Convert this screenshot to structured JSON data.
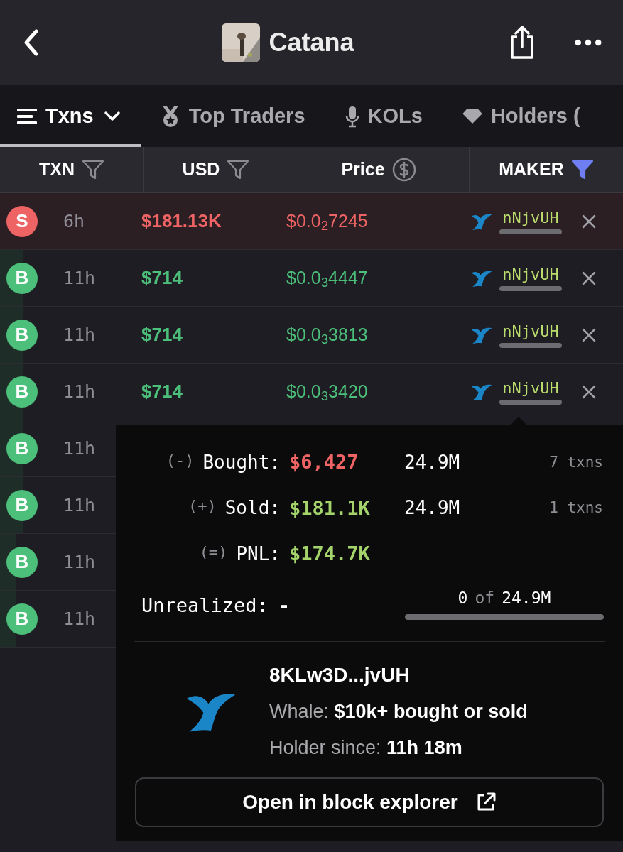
{
  "header": {
    "title": "Catana"
  },
  "tabs": [
    {
      "label": "Txns",
      "kind": "menu",
      "selected": true
    },
    {
      "label": "Top Traders",
      "kind": "medal",
      "selected": false
    },
    {
      "label": "KOLs",
      "kind": "mic",
      "selected": false
    },
    {
      "label": "Holders (",
      "kind": "diamond",
      "selected": false
    }
  ],
  "table": {
    "columns": [
      {
        "label": "TXN",
        "kind": "filter",
        "active": false
      },
      {
        "label": "USD",
        "kind": "filter",
        "active": false
      },
      {
        "label": "Price",
        "kind": "dollar",
        "active": false
      },
      {
        "label": "MAKER",
        "kind": "filter",
        "active": true
      }
    ],
    "rows": [
      {
        "side": "S",
        "time": "6h",
        "usd": "$181.13K",
        "price": "$0.0$_{2}$7245",
        "maker": "nNjvUH",
        "level": 1
      },
      {
        "side": "B",
        "time": "11h",
        "usd": "$714",
        "price": "$0.0$_{3}$4447",
        "maker": "nNjvUH",
        "level": 0.036
      },
      {
        "side": "B",
        "time": "11h",
        "usd": "$714",
        "price": "$0.0$_{3}$3813",
        "maker": "nNjvUH",
        "level": 0.036
      },
      {
        "side": "B",
        "time": "11h",
        "usd": "$714",
        "price": "$0.0$_{3}$3420",
        "maker": "nNjvUH",
        "level": 0.036
      },
      {
        "side": "B",
        "time": "11h",
        "level": 0.036
      },
      {
        "side": "B",
        "time": "11h",
        "level": 0.036
      },
      {
        "side": "B",
        "time": "11h",
        "level": 0.025
      },
      {
        "side": "B",
        "time": "11h",
        "level": 0.025
      }
    ]
  },
  "popup": {
    "stats": [
      {
        "sign": "(-)",
        "label": "Bought:",
        "amount": "$6,427",
        "color": "#ee6464",
        "tokens": "24.9M",
        "txns": "7 txns"
      },
      {
        "sign": "(+)",
        "label": "Sold:",
        "amount": "$181.1K",
        "color": "#a3d36a",
        "tokens": "24.9M",
        "txns": "1 txns"
      },
      {
        "sign": "(=)",
        "label": "PNL:",
        "amount": "$174.7K",
        "color": "#a3d36a"
      }
    ],
    "unrealized": {
      "label": "Unrealized:",
      "value": "-",
      "held": "0",
      "of": "of",
      "total": "24.9M",
      "level": 0
    },
    "wallet": {
      "address": "8KLw3D...jvUH",
      "type": "Whale: **$10k+ bought or sold**",
      "since": "Holder since: **11h 18m**"
    },
    "button": "Open in block explorer"
  }
}
